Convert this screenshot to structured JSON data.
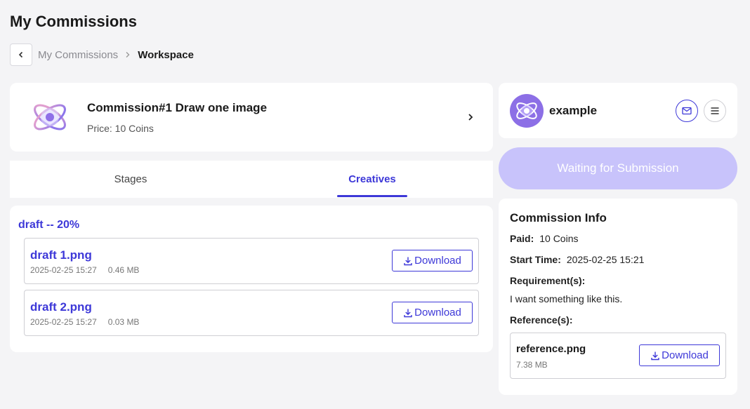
{
  "page": {
    "title": "My Commissions"
  },
  "breadcrumb": {
    "parent": "My Commissions",
    "current": "Workspace"
  },
  "commission": {
    "title": "Commission#1 Draw one image",
    "price": "Price: 10 Coins"
  },
  "tabs": [
    {
      "label": "Stages",
      "active": false
    },
    {
      "label": "Creatives",
      "active": true
    }
  ],
  "creatives": {
    "stage_label": "draft -- 20%",
    "files": [
      {
        "name": "draft 1.png",
        "date": "2025-02-25 15:27",
        "size": "0.46 MB",
        "button": "Download"
      },
      {
        "name": "draft 2.png",
        "date": "2025-02-25 15:27",
        "size": "0.03 MB",
        "button": "Download"
      }
    ]
  },
  "user": {
    "name": "example"
  },
  "status_button": "Waiting for Submission",
  "info": {
    "title": "Commission Info",
    "paid_label": "Paid:",
    "paid_value": "10 Coins",
    "start_label": "Start Time:",
    "start_value": "2025-02-25 15:21",
    "requirement_label": "Requirement(s):",
    "requirement_value": "I want something like this.",
    "reference_label": "Reference(s):",
    "reference": {
      "name": "reference.png",
      "size": "7.38 MB",
      "button": "Download"
    }
  },
  "colors": {
    "accent": "#3d38d8",
    "status_button_bg": "#c8c3fb",
    "avatar_bg": "#8c6fe6",
    "background": "#f4f4f6"
  },
  "icons": [
    "chevron-left-icon",
    "chevron-right-icon",
    "atom-logo-icon",
    "download-icon",
    "mail-icon",
    "menu-icon"
  ]
}
